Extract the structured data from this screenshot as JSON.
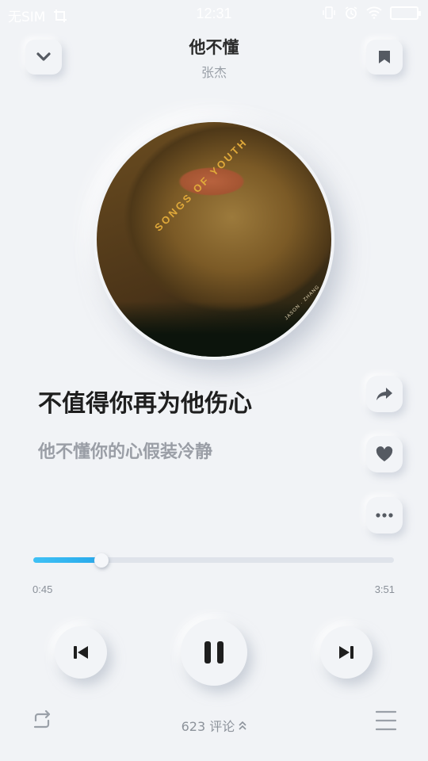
{
  "status_bar": {
    "carrier": "无SIM",
    "time": "12:31"
  },
  "song": {
    "title": "他不懂",
    "artist": "张杰"
  },
  "album": {
    "cover_text": "SONGS OF YOUTH",
    "cover_artist": "JASON · ZHANG"
  },
  "lyrics": {
    "current": "不值得你再为他伤心",
    "next": "他不懂你的心假装冷静"
  },
  "playback": {
    "elapsed": "0:45",
    "duration": "3:51",
    "progress_fraction": 0.19,
    "state": "playing"
  },
  "footer": {
    "comment_count": "623",
    "comment_label": "评论"
  },
  "colors": {
    "background": "#f1f3f6",
    "accent": "#27a8ea",
    "icon": "#555a62"
  },
  "icons": [
    "chevron-down-icon",
    "bookmark-icon",
    "share-icon",
    "heart-icon",
    "more-icon",
    "previous-icon",
    "pause-icon",
    "next-icon",
    "repeat-icon",
    "playlist-icon"
  ]
}
